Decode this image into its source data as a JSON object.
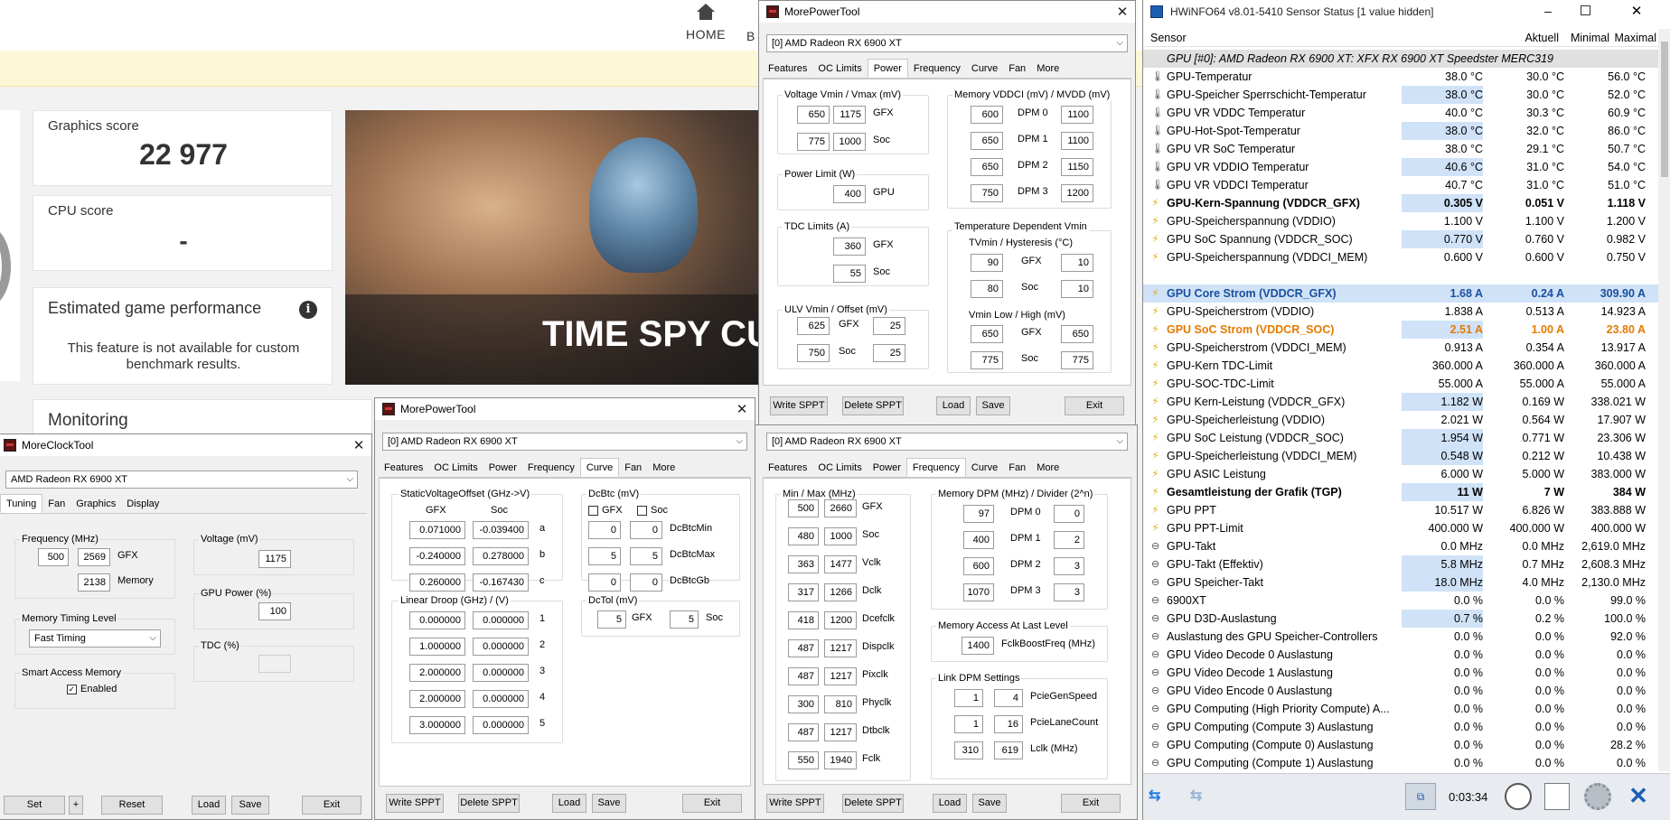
{
  "threedmark": {
    "nav_home": "HOME",
    "nav_partial": "B",
    "graphics_score_label": "Graphics score",
    "graphics_score_value": "22 977",
    "cpu_score_label": "CPU score",
    "cpu_score_value": "-",
    "est_game_perf_title": "Estimated game performance",
    "est_game_perf_text": "This feature is not available for custom benchmark results.",
    "monitoring_label": "Monitoring",
    "hero_text": "TIME SPY CU"
  },
  "mpt_power": {
    "title": "MorePowerTool",
    "device": "[0] AMD Radeon RX 6900 XT",
    "tabs": [
      "Features",
      "OC Limits",
      "Power",
      "Frequency",
      "Curve",
      "Fan",
      "More"
    ],
    "active_tab": "Power",
    "voltage_group": "Voltage Vmin / Vmax (mV)",
    "voltage_rows": [
      {
        "a": "650",
        "b": "1175",
        "lbl": "GFX"
      },
      {
        "a": "775",
        "b": "1000",
        "lbl": "Soc"
      }
    ],
    "power_limit_group": "Power Limit (W)",
    "power_limit_value": "400",
    "power_limit_lbl": "GPU",
    "tdc_group": "TDC Limits (A)",
    "tdc_rows": [
      {
        "v": "360",
        "lbl": "GFX"
      },
      {
        "v": "55",
        "lbl": "Soc"
      }
    ],
    "ulv_group": "ULV Vmin / Offset (mV)",
    "ulv_rows": [
      {
        "a": "625",
        "lbl": "GFX",
        "b": "25"
      },
      {
        "a": "750",
        "lbl": "Soc",
        "b": "25"
      }
    ],
    "mem_group": "Memory VDDCI (mV) / MVDD (mV)",
    "mem_rows": [
      {
        "a": "600",
        "lbl": "DPM 0",
        "b": "1100"
      },
      {
        "a": "650",
        "lbl": "DPM 1",
        "b": "1100"
      },
      {
        "a": "650",
        "lbl": "DPM 2",
        "b": "1150"
      },
      {
        "a": "750",
        "lbl": "DPM 3",
        "b": "1200"
      }
    ],
    "temp_group": "Temperature Dependent Vmin",
    "tvmin_label": "TVmin / Hysteresis (°C)",
    "tvmin_rows": [
      {
        "a": "90",
        "lbl": "GFX",
        "b": "10"
      },
      {
        "a": "80",
        "lbl": "Soc",
        "b": "10"
      }
    ],
    "vmin_label": "Vmin Low / High (mV)",
    "vmin_rows": [
      {
        "a": "650",
        "lbl": "GFX",
        "b": "650"
      },
      {
        "a": "775",
        "lbl": "Soc",
        "b": "775"
      }
    ],
    "btn_write": "Write SPPT",
    "btn_delete": "Delete SPPT",
    "btn_load": "Load",
    "btn_save": "Save",
    "btn_exit": "Exit"
  },
  "mpt_curve": {
    "title": "MorePowerTool",
    "device": "[0] AMD Radeon RX 6900 XT",
    "tabs": [
      "Features",
      "OC Limits",
      "Power",
      "Frequency",
      "Curve",
      "Fan",
      "More"
    ],
    "active_tab": "Curve",
    "svo_group": "StaticVoltageOffset (GHz->V)",
    "svo_head_gfx": "GFX",
    "svo_head_soc": "Soc",
    "svo_rows": [
      {
        "a": "0.071000",
        "b": "-0.039400",
        "lbl": "a"
      },
      {
        "a": "-0.240000",
        "b": "0.278000",
        "lbl": "b"
      },
      {
        "a": "0.260000",
        "b": "-0.167430",
        "lbl": "c"
      }
    ],
    "dcbtc_group": "DcBtc (mV)",
    "dcbtc_gfx": "GFX",
    "dcbtc_soc": "Soc",
    "dcbtc_rows": [
      {
        "a": "0",
        "b": "0",
        "lbl": "DcBtcMin"
      },
      {
        "a": "5",
        "b": "5",
        "lbl": "DcBtcMax"
      },
      {
        "a": "0",
        "b": "0",
        "lbl": "DcBtcGb"
      }
    ],
    "ld_group": "Linear Droop (GHz) / (V)",
    "ld_rows": [
      {
        "a": "0.000000",
        "b": "0.000000",
        "lbl": "1"
      },
      {
        "a": "1.000000",
        "b": "0.000000",
        "lbl": "2"
      },
      {
        "a": "2.000000",
        "b": "0.000000",
        "lbl": "3"
      },
      {
        "a": "2.000000",
        "b": "0.000000",
        "lbl": "4"
      },
      {
        "a": "3.000000",
        "b": "0.000000",
        "lbl": "5"
      }
    ],
    "dctol_group": "DcTol (mV)",
    "dctol_gfx_val": "5",
    "dctol_gfx": "GFX",
    "dctol_soc_val": "5",
    "dctol_soc": "Soc",
    "btn_write": "Write SPPT",
    "btn_delete": "Delete SPPT",
    "btn_load": "Load",
    "btn_save": "Save",
    "btn_exit": "Exit"
  },
  "mpt_freq": {
    "device": "[0] AMD Radeon RX 6900 XT",
    "tabs": [
      "Features",
      "OC Limits",
      "Power",
      "Frequency",
      "Curve",
      "Fan",
      "More"
    ],
    "active_tab": "Frequency",
    "minmax_group": "Min / Max (MHz)",
    "minmax_rows": [
      {
        "a": "500",
        "b": "2660",
        "lbl": "GFX"
      },
      {
        "a": "480",
        "b": "1000",
        "lbl": "Soc"
      },
      {
        "a": "363",
        "b": "1477",
        "lbl": "Vclk"
      },
      {
        "a": "317",
        "b": "1266",
        "lbl": "Dclk"
      },
      {
        "a": "418",
        "b": "1200",
        "lbl": "Dcefclk"
      },
      {
        "a": "487",
        "b": "1217",
        "lbl": "Dispclk"
      },
      {
        "a": "487",
        "b": "1217",
        "lbl": "Pixclk"
      },
      {
        "a": "300",
        "b": "810",
        "lbl": "Phyclk"
      },
      {
        "a": "487",
        "b": "1217",
        "lbl": "Dtbclk"
      },
      {
        "a": "550",
        "b": "1940",
        "lbl": "Fclk"
      }
    ],
    "memdpm_group": "Memory DPM (MHz) / Divider (2^n)",
    "memdpm_rows": [
      {
        "a": "97",
        "lbl": "DPM 0",
        "b": "0"
      },
      {
        "a": "400",
        "lbl": "DPM 1",
        "b": "2"
      },
      {
        "a": "600",
        "lbl": "DPM 2",
        "b": "3"
      },
      {
        "a": "1070",
        "lbl": "DPM 3",
        "b": "3"
      }
    ],
    "memaccess_group": "Memory Access At Last Level",
    "memaccess_val": "1400",
    "memaccess_lbl": "FclkBoostFreq (MHz)",
    "linkdpm_group": "Link DPM Settings",
    "linkdpm_rows": [
      {
        "a": "1",
        "b": "4",
        "lbl": "PcieGenSpeed"
      },
      {
        "a": "1",
        "b": "16",
        "lbl": "PcieLaneCount"
      },
      {
        "a": "310",
        "b": "619",
        "lbl": "Lclk (MHz)"
      }
    ],
    "btn_write": "Write SPPT",
    "btn_delete": "Delete SPPT",
    "btn_load": "Load",
    "btn_save": "Save",
    "btn_exit": "Exit"
  },
  "mct": {
    "title": "MoreClockTool",
    "device": "AMD Radeon RX 6900 XT",
    "tabs": [
      "Tuning",
      "Fan",
      "Graphics",
      "Display"
    ],
    "active_tab": "Tuning",
    "freq_group": "Frequency (MHz)",
    "freq_min": "500",
    "freq_max": "2569",
    "freq_gfx": "GFX",
    "freq_mem": "2138",
    "freq_mem_lbl": "Memory",
    "voltage_group": "Voltage (mV)",
    "voltage_val": "1175",
    "gpu_power_group": "GPU Power (%)",
    "gpu_power_val": "100",
    "tdc_group": "TDC (%)",
    "tdc_val": "",
    "mem_timing_group": "Memory Timing Level",
    "mem_timing_val": "Fast Timing",
    "sam_group": "Smart Access Memory",
    "sam_enabled": "Enabled",
    "btn_set": "Set",
    "btn_plus": "+",
    "btn_reset": "Reset",
    "btn_load": "Load",
    "btn_save": "Save",
    "btn_exit": "Exit"
  },
  "hwinfo": {
    "title": "HWiNFO64 v8.01-5410 Sensor Status [1 value hidden]",
    "col_sensor": "Sensor",
    "col_current": "Aktuell",
    "col_min": "Minimal",
    "col_max": "Maximal",
    "group_header": "GPU [#0]: AMD Radeon RX 6900 XT: XFX RX 6900 XT Speedster MERC319",
    "rows": [
      {
        "icon": "thermometer-icon",
        "name": "GPU-Temperatur",
        "cur": "38.0 °C",
        "min": "30.0 °C",
        "max": "56.0 °C",
        "style": "",
        "hl": ""
      },
      {
        "icon": "thermometer-icon",
        "name": "GPU-Speicher Sperrschicht-Temperatur",
        "cur": "38.0 °C",
        "min": "30.0 °C",
        "max": "52.0 °C",
        "style": "",
        "hl": "cur"
      },
      {
        "icon": "thermometer-icon",
        "name": "GPU VR VDDC Temperatur",
        "cur": "40.0 °C",
        "min": "30.3 °C",
        "max": "60.9 °C",
        "style": "",
        "hl": ""
      },
      {
        "icon": "thermometer-icon",
        "name": "GPU-Hot-Spot-Temperatur",
        "cur": "38.0 °C",
        "min": "32.0 °C",
        "max": "86.0 °C",
        "style": "",
        "hl": "cur"
      },
      {
        "icon": "thermometer-icon",
        "name": "GPU VR SoC Temperatur",
        "cur": "38.0 °C",
        "min": "29.1 °C",
        "max": "50.7 °C",
        "style": "",
        "hl": ""
      },
      {
        "icon": "thermometer-icon",
        "name": "GPU VR VDDIO Temperatur",
        "cur": "40.6 °C",
        "min": "31.0 °C",
        "max": "54.0 °C",
        "style": "",
        "hl": "cur"
      },
      {
        "icon": "thermometer-icon",
        "name": "GPU VR VDDCI Temperatur",
        "cur": "40.7 °C",
        "min": "31.0 °C",
        "max": "51.0 °C",
        "style": "",
        "hl": ""
      },
      {
        "icon": "bolt-icon",
        "name": "GPU-Kern-Spannung (VDDCR_GFX)",
        "cur": "0.305 V",
        "min": "0.051 V",
        "max": "1.118 V",
        "style": "bold",
        "hl": "cur"
      },
      {
        "icon": "bolt-icon",
        "name": "GPU-Speicherspannung (VDDIO)",
        "cur": "1.100 V",
        "min": "1.100 V",
        "max": "1.200 V",
        "style": "",
        "hl": ""
      },
      {
        "icon": "bolt-icon",
        "name": "GPU SoC Spannung (VDDCR_SOC)",
        "cur": "0.770 V",
        "min": "0.760 V",
        "max": "0.982 V",
        "style": "",
        "hl": "cur"
      },
      {
        "icon": "bolt-icon",
        "name": "GPU-Speicherspannung (VDDCI_MEM)",
        "cur": "0.600 V",
        "min": "0.600 V",
        "max": "0.750 V",
        "style": "",
        "hl": ""
      },
      {
        "icon": "",
        "name": "",
        "cur": "",
        "min": "",
        "max": "",
        "style": "",
        "hl": ""
      },
      {
        "icon": "bolt-icon",
        "name": "GPU Core Strom (VDDCR_GFX)",
        "cur": "1.68 A",
        "min": "0.24 A",
        "max": "309.90 A",
        "style": "bold blue",
        "hl": "row"
      },
      {
        "icon": "bolt-icon",
        "name": "GPU-Speicherstrom (VDDIO)",
        "cur": "1.838 A",
        "min": "0.513 A",
        "max": "14.923 A",
        "style": "",
        "hl": ""
      },
      {
        "icon": "bolt-icon",
        "name": "GPU SoC Strom (VDDCR_SOC)",
        "cur": "2.51 A",
        "min": "1.00 A",
        "max": "23.80 A",
        "style": "bold orange",
        "hl": "cur"
      },
      {
        "icon": "bolt-icon",
        "name": "GPU-Speicherstrom (VDDCI_MEM)",
        "cur": "0.913 A",
        "min": "0.354 A",
        "max": "13.917 A",
        "style": "",
        "hl": ""
      },
      {
        "icon": "bolt-icon",
        "name": "GPU-Kern TDC-Limit",
        "cur": "360.000 A",
        "min": "360.000 A",
        "max": "360.000 A",
        "style": "",
        "hl": ""
      },
      {
        "icon": "bolt-icon",
        "name": "GPU-SOC-TDC-Limit",
        "cur": "55.000 A",
        "min": "55.000 A",
        "max": "55.000 A",
        "style": "",
        "hl": ""
      },
      {
        "icon": "bolt-icon",
        "name": "GPU Kern-Leistung (VDDCR_GFX)",
        "cur": "1.182 W",
        "min": "0.169 W",
        "max": "338.021 W",
        "style": "",
        "hl": "cur"
      },
      {
        "icon": "bolt-icon",
        "name": "GPU-Speicherleistung (VDDIO)",
        "cur": "2.021 W",
        "min": "0.564 W",
        "max": "17.907 W",
        "style": "",
        "hl": ""
      },
      {
        "icon": "bolt-icon",
        "name": "GPU SoC Leistung (VDDCR_SOC)",
        "cur": "1.954 W",
        "min": "0.771 W",
        "max": "23.306 W",
        "style": "",
        "hl": "cur"
      },
      {
        "icon": "bolt-icon",
        "name": "GPU-Speicherleistung (VDDCI_MEM)",
        "cur": "0.548 W",
        "min": "0.212 W",
        "max": "10.438 W",
        "style": "",
        "hl": "cur"
      },
      {
        "icon": "bolt-icon",
        "name": "GPU ASIC Leistung",
        "cur": "6.000 W",
        "min": "5.000 W",
        "max": "383.000 W",
        "style": "",
        "hl": ""
      },
      {
        "icon": "bolt-icon",
        "name": "Gesamtleistung der Grafik (TGP)",
        "cur": "11 W",
        "min": "7 W",
        "max": "384 W",
        "style": "bold",
        "hl": "cur"
      },
      {
        "icon": "bolt-icon",
        "name": "GPU PPT",
        "cur": "10.517 W",
        "min": "6.826 W",
        "max": "383.888 W",
        "style": "",
        "hl": ""
      },
      {
        "icon": "bolt-icon",
        "name": "GPU PPT-Limit",
        "cur": "400.000 W",
        "min": "400.000 W",
        "max": "400.000 W",
        "style": "",
        "hl": ""
      },
      {
        "icon": "clock-icon",
        "name": "GPU-Takt",
        "cur": "0.0 MHz",
        "min": "0.0 MHz",
        "max": "2,619.0 MHz",
        "style": "",
        "hl": ""
      },
      {
        "icon": "clock-icon",
        "name": "GPU-Takt (Effektiv)",
        "cur": "5.8 MHz",
        "min": "0.7 MHz",
        "max": "2,608.3 MHz",
        "style": "",
        "hl": "cur"
      },
      {
        "icon": "clock-icon",
        "name": "GPU Speicher-Takt",
        "cur": "18.0 MHz",
        "min": "4.0 MHz",
        "max": "2,130.0 MHz",
        "style": "",
        "hl": "cur"
      },
      {
        "icon": "clock-icon",
        "name": "6900XT",
        "cur": "0.0 %",
        "min": "0.0 %",
        "max": "99.0 %",
        "style": "",
        "hl": ""
      },
      {
        "icon": "clock-icon",
        "name": "GPU D3D-Auslastung",
        "cur": "0.7 %",
        "min": "0.2 %",
        "max": "100.0 %",
        "style": "",
        "hl": "cur"
      },
      {
        "icon": "clock-icon",
        "name": "Auslastung des GPU Speicher-Controllers",
        "cur": "0.0 %",
        "min": "0.0 %",
        "max": "92.0 %",
        "style": "",
        "hl": ""
      },
      {
        "icon": "clock-icon",
        "name": "GPU Video Decode 0 Auslastung",
        "cur": "0.0 %",
        "min": "0.0 %",
        "max": "0.0 %",
        "style": "",
        "hl": ""
      },
      {
        "icon": "clock-icon",
        "name": "GPU Video Decode 1 Auslastung",
        "cur": "0.0 %",
        "min": "0.0 %",
        "max": "0.0 %",
        "style": "",
        "hl": ""
      },
      {
        "icon": "clock-icon",
        "name": "GPU Video Encode 0 Auslastung",
        "cur": "0.0 %",
        "min": "0.0 %",
        "max": "0.0 %",
        "style": "",
        "hl": ""
      },
      {
        "icon": "clock-icon",
        "name": "GPU Computing (High Priority Compute) A...",
        "cur": "0.0 %",
        "min": "0.0 %",
        "max": "0.0 %",
        "style": "",
        "hl": ""
      },
      {
        "icon": "clock-icon",
        "name": "GPU Computing (Compute 3) Auslastung",
        "cur": "0.0 %",
        "min": "0.0 %",
        "max": "0.0 %",
        "style": "",
        "hl": ""
      },
      {
        "icon": "clock-icon",
        "name": "GPU Computing (Compute 0) Auslastung",
        "cur": "0.0 %",
        "min": "0.0 %",
        "max": "28.2 %",
        "style": "",
        "hl": ""
      },
      {
        "icon": "clock-icon",
        "name": "GPU Computing (Compute 1) Auslastung",
        "cur": "0.0 %",
        "min": "0.0 %",
        "max": "0.0 %",
        "style": "",
        "hl": ""
      }
    ],
    "elapsed": "0:03:34"
  }
}
